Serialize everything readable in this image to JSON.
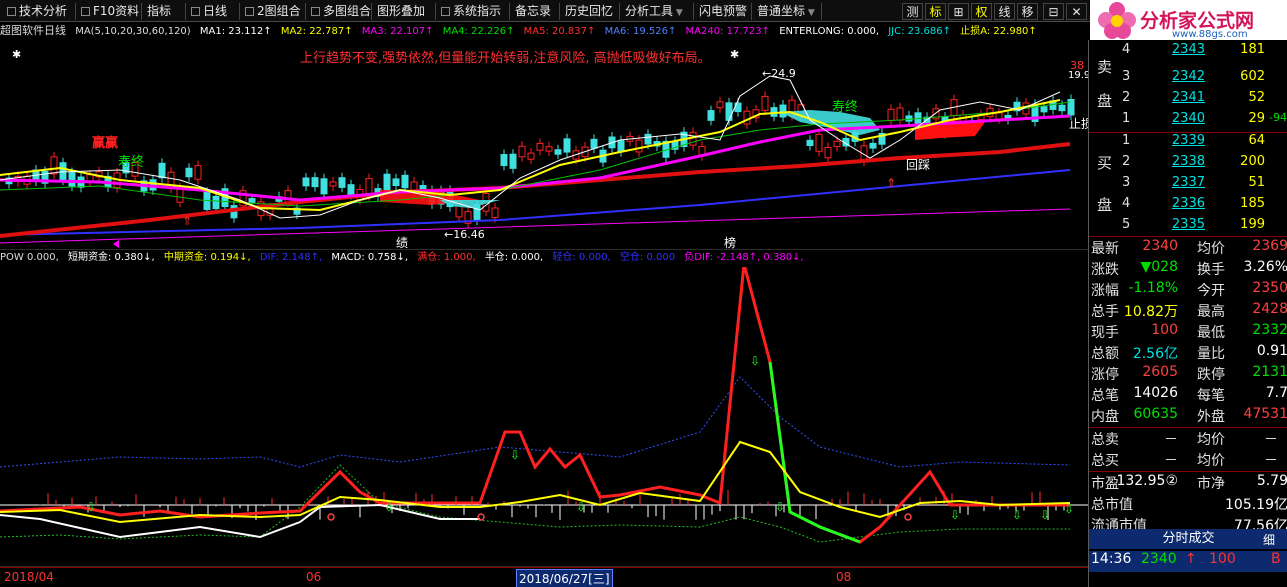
{
  "toolbar": {
    "items": [
      "技术分析",
      "F10资料",
      "指标",
      "日线",
      "2图组合",
      "多图组合",
      "图形叠加",
      "系统指示",
      "备忘录",
      "历史回忆",
      "分析工具",
      "闪电预警",
      "普通坐标"
    ],
    "right_buttons": [
      "测",
      "标",
      "⊞",
      "权",
      "线",
      "移",
      "⊟",
      "✕"
    ]
  },
  "logo": {
    "brand": "分析家公式网",
    "url": "www.88gs.com"
  },
  "main_chart": {
    "info": {
      "title": "超图软件日线",
      "ma_params": "MA(5,10,20,30,60,120)",
      "ma1": "MA1: 23.112↑",
      "ma2": "MA2: 22.787↑",
      "ma3": "MA3: 22.107↑",
      "ma4": "MA4: 22.226↑",
      "ma5": "MA5: 20.837↑",
      "ma6": "MA6: 19.526↑",
      "ma240": "MA240: 17.723↑",
      "enterlong": "ENTERLONG: 0.000,",
      "jjc": "JJC: 23.686↑",
      "zhisun": "止损A: 22.980↑"
    },
    "commentary": "上行趋势不变,强势依然,但量能开始转弱,注意风险, 高抛低吸做好布局。",
    "labels": {
      "shoushi1": "寿终",
      "shoushi2": "寿终",
      "huicai": "回踩",
      "hi_price": "24.9",
      "lo_price": "16.46",
      "ji": "绩",
      "bang": "榜",
      "zhisun_short": "止损",
      "right_top": "19.9",
      "right_red": "38"
    }
  },
  "sub_chart": {
    "info": {
      "pow": "POW 0.000,",
      "short_fund": "短期资金: 0.380↓,",
      "mid_fund": "中期资金: 0.194↓,",
      "dif1": "DIF: 2.148↑,",
      "macd": "MACD: 0.758↓,",
      "full": "满仓: 1.000,",
      "half": "半仓: 0.000,",
      "light": "轻仓: 0.000,",
      "empty": "空仓: 0.000",
      "dif2": "负DIF: -2.148↑, 0.380↓,"
    }
  },
  "x_axis": {
    "labels": [
      "2018/04",
      "06",
      "2018/06/27[三]",
      "08"
    ]
  },
  "order_book": {
    "sell_label": [
      "卖",
      "盘"
    ],
    "buy_label": [
      "买",
      "盘"
    ],
    "sell": [
      {
        "level": "4",
        "price": "2343",
        "vol": "181"
      },
      {
        "level": "3",
        "price": "2342",
        "vol": "602"
      },
      {
        "level": "2",
        "price": "2341",
        "vol": "52"
      },
      {
        "level": "1",
        "price": "2340",
        "vol": "29"
      }
    ],
    "sell_extra": "-94",
    "buy": [
      {
        "level": "1",
        "price": "2339",
        "vol": "64"
      },
      {
        "level": "2",
        "price": "2338",
        "vol": "200"
      },
      {
        "level": "3",
        "price": "2337",
        "vol": "51"
      },
      {
        "level": "4",
        "price": "2336",
        "vol": "185"
      },
      {
        "level": "5",
        "price": "2335",
        "vol": "199"
      }
    ]
  },
  "stats": [
    {
      "l": "最新",
      "v": "2340",
      "l2": "均价",
      "v2": "2369",
      "vc": "#ff4040",
      "v2c": "#ff4040"
    },
    {
      "l": "涨跌",
      "v": "▼028",
      "l2": "换手",
      "v2": "3.26%",
      "vc": "#00e000",
      "v2c": "#ffffff"
    },
    {
      "l": "涨幅",
      "v": "-1.18%",
      "l2": "今开",
      "v2": "2350",
      "vc": "#00e000",
      "v2c": "#ff4040"
    },
    {
      "l": "总手",
      "v": "10.82万",
      "l2": "最高",
      "v2": "2428",
      "vc": "#ffff00",
      "v2c": "#ff4040"
    },
    {
      "l": "现手",
      "v": "100",
      "l2": "最低",
      "v2": "2332",
      "vc": "#ff4040",
      "v2c": "#00e000"
    },
    {
      "l": "总额",
      "v": "2.56亿",
      "l2": "量比",
      "v2": "0.91",
      "vc": "#00e0e0",
      "v2c": "#ffffff"
    },
    {
      "l": "涨停",
      "v": "2605",
      "l2": "跌停",
      "v2": "2131",
      "vc": "#ff4040",
      "v2c": "#00e000"
    },
    {
      "l": "总笔",
      "v": "14026",
      "l2": "每笔",
      "v2": "7.7",
      "vc": "#ffffff",
      "v2c": "#ffffff"
    },
    {
      "l": "内盘",
      "v": "60635",
      "l2": "外盘",
      "v2": "47531",
      "vc": "#00e000",
      "v2c": "#ff4040"
    }
  ],
  "stats2": [
    {
      "l": "总卖",
      "v": "－",
      "l2": "均价",
      "v2": "－"
    },
    {
      "l": "总买",
      "v": "－",
      "l2": "均价",
      "v2": "－"
    }
  ],
  "valuation": {
    "pe_label": "市盈",
    "pe": "132.95②",
    "pb_label": "市净",
    "pb": "5.79",
    "mcap_label": "总市值",
    "mcap": "105.19亿",
    "float_label": "流通市值",
    "float": "77.56亿"
  },
  "ticks": {
    "tab": "分时成交",
    "tab2": "细",
    "time": "14:36",
    "price": "2340",
    "arrow": "↑",
    "vol": "100",
    "code": "B"
  }
}
